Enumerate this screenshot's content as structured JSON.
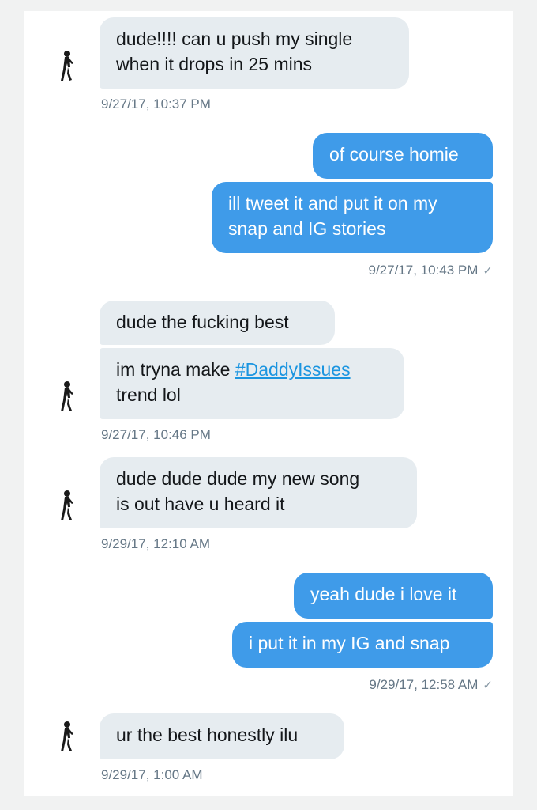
{
  "conversation": {
    "groups": [
      {
        "side": "received",
        "messages": [
          "dude!!!! can u push my single\nwhen it drops in 25 mins"
        ],
        "timestamp": "9/27/17, 10:37 PM"
      },
      {
        "side": "sent",
        "messages": [
          "of course homie",
          "ill tweet it and put it on my\nsnap and IG stories"
        ],
        "timestamp": "9/27/17, 10:43 PM",
        "read": true
      },
      {
        "side": "received",
        "messages": [
          "dude the fucking best"
        ],
        "msg2": {
          "prefix": "im tryna make ",
          "hashtag": "#DaddyIssues",
          "suffix": "trend lol"
        },
        "timestamp": "9/27/17, 10:46 PM"
      },
      {
        "side": "received",
        "messages": [
          "dude dude dude my new song\nis out have u heard it"
        ],
        "timestamp": "9/29/17, 12:10 AM"
      },
      {
        "side": "sent",
        "messages": [
          "yeah dude i love it",
          "i put it in my IG and snap"
        ],
        "timestamp": "9/29/17, 12:58 AM",
        "read": true
      },
      {
        "side": "received",
        "messages": [
          "ur the best honestly ilu"
        ],
        "timestamp": "9/29/17, 1:00 AM"
      }
    ],
    "read_receipt_icon": "checkmark-icon",
    "colors": {
      "sent_bubble": "#3f9be9",
      "received_bubble": "#e6ecf0",
      "timestamp": "#657786",
      "hashtag": "#1b95e0"
    }
  }
}
